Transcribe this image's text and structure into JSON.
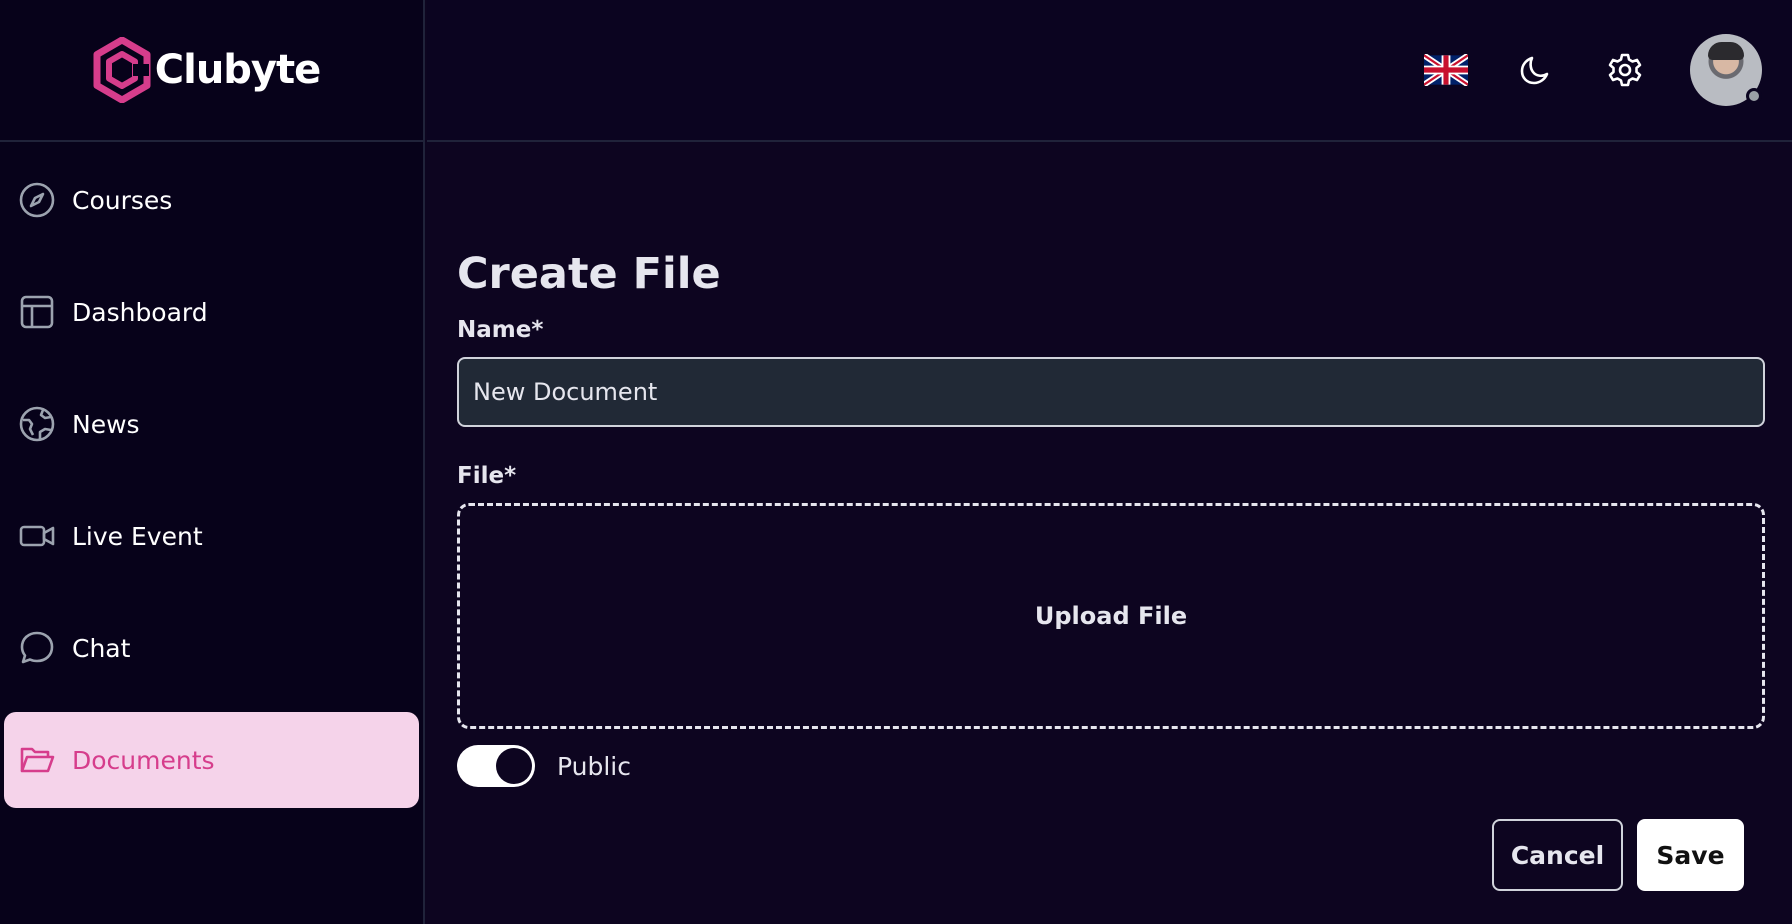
{
  "app": {
    "name": "Clubyte",
    "brand_color": "#d63d8c"
  },
  "sidebar": {
    "items": [
      {
        "label": "Courses",
        "icon": "compass-icon"
      },
      {
        "label": "Dashboard",
        "icon": "layout-icon"
      },
      {
        "label": "News",
        "icon": "globe-icon"
      },
      {
        "label": "Live Event",
        "icon": "video-icon"
      },
      {
        "label": "Chat",
        "icon": "chat-bubble-icon"
      },
      {
        "label": "Documents",
        "icon": "folder-open-icon",
        "active": true
      }
    ]
  },
  "header": {
    "icons": [
      "uk-flag-icon",
      "moon-icon",
      "gear-icon",
      "avatar"
    ]
  },
  "form": {
    "title": "Create File",
    "name_label": "Name*",
    "name_value": "New Document",
    "file_label": "File*",
    "upload_text": "Upload File",
    "public_label": "Public",
    "public_enabled": true,
    "cancel_label": "Cancel",
    "save_label": "Save"
  }
}
